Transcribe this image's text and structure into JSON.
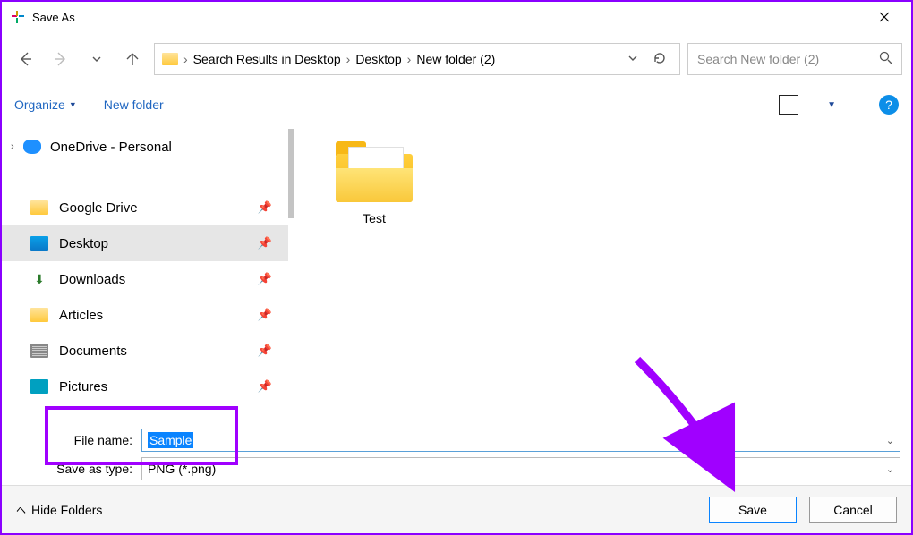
{
  "window": {
    "title": "Save As"
  },
  "breadcrumbs": {
    "items": [
      "Search Results in Desktop",
      "Desktop",
      "New folder (2)"
    ]
  },
  "search": {
    "placeholder": "Search New folder (2)"
  },
  "toolbar": {
    "organize": "Organize",
    "newfolder": "New folder"
  },
  "tree": {
    "onedrive": "OneDrive - Personal",
    "quick": [
      {
        "label": "Google Drive"
      },
      {
        "label": "Desktop"
      },
      {
        "label": "Downloads"
      },
      {
        "label": "Articles"
      },
      {
        "label": "Documents"
      },
      {
        "label": "Pictures"
      }
    ]
  },
  "content": {
    "folder_name": "Test"
  },
  "fields": {
    "filename_label": "File name:",
    "filename_value": "Sample",
    "saveastype_label": "Save as type:",
    "saveastype_value": "PNG (*.png)"
  },
  "footer": {
    "hide_folders": "Hide Folders",
    "save": "Save",
    "cancel": "Cancel"
  }
}
